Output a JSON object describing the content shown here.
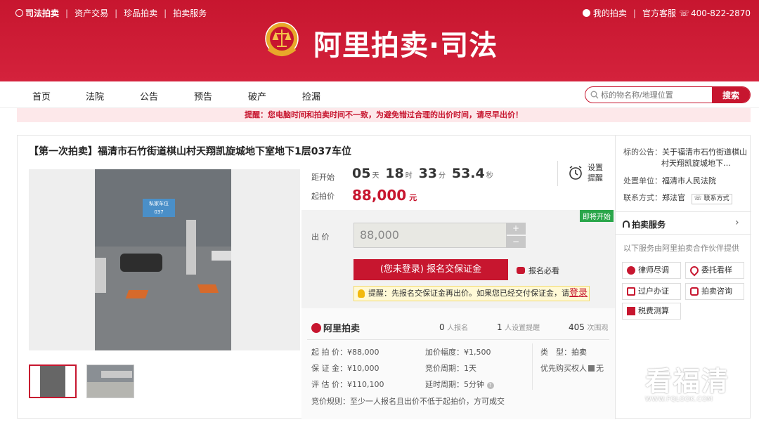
{
  "topbar": {
    "brand": "司法拍卖",
    "links": [
      "资产交易",
      "珍品拍卖",
      "拍卖服务"
    ],
    "my_auction": "我的拍卖",
    "service": "官方客服",
    "phone": "400-822-2870"
  },
  "header": {
    "title": "阿里拍卖·司法"
  },
  "nav": {
    "items": [
      "首页",
      "法院",
      "公告",
      "预告",
      "破产",
      "捡漏"
    ],
    "search_placeholder": "标的物名称/地理位置",
    "search_button": "搜索"
  },
  "notice": "提醒：您电脑时间和拍卖时间不一致，为避免错过合理的出价时间，请尽早出价！",
  "item": {
    "title": "【第一次拍卖】福清市石竹街道棋山村天翔凯旋城地下室地下1层037车位",
    "photo_sign": "私家车位\n037"
  },
  "countdown": {
    "label": "距开始",
    "days": "05",
    "days_unit": "天",
    "hours": "18",
    "hours_unit": "时",
    "minutes": "33",
    "minutes_unit": "分",
    "seconds": "53.4",
    "seconds_unit": "秒"
  },
  "remind": {
    "line1": "设置",
    "line2": "提醒"
  },
  "start_price": {
    "label": "起拍价",
    "value": "88,000",
    "unit": "元"
  },
  "bid": {
    "badge": "即将开始",
    "label": "出 价",
    "value": "88,000",
    "plus": "+",
    "minus": "−",
    "register_button": "(您未登录) 报名交保证金",
    "must_read": "报名必看",
    "tip_text": "提醒：先报名交保证金再出价。如果您已经交付保证金，请",
    "tip_link": "登录"
  },
  "stats": {
    "logo": "阿里拍卖",
    "signup_count": "0",
    "signup_label": "人报名",
    "reminder_count": "1",
    "reminder_label": "人设置提醒",
    "view_count": "405",
    "view_label": "次围观",
    "start_price": "起 拍 价：¥88,000",
    "increment": "加价幅度：¥1,500",
    "type": "类　型：",
    "type_value": "拍卖",
    "deposit": "保 证 金：¥10,000",
    "bid_period": "竞价周期：1天",
    "priority": "优先购买权人",
    "priority_value": "无",
    "appraisal": "评 估 价：¥110,100",
    "extend_period": "延时周期：5分钟",
    "rule": "竞价规则：至少一人报名且出价不低于起拍价，方可成交"
  },
  "sidebar": {
    "notice_label": "标的公告：",
    "notice_value": "关于福清市石竹街道棋山村天翔凯旋城地下…",
    "court_label": "处置单位：",
    "court_value": "福清市人民法院",
    "contact_label": "联系方式：",
    "contact_value": "郑法官",
    "contact_btn": "联系方式",
    "service_title": "拍卖服务",
    "service_desc": "以下服务由阿里拍卖合作伙伴提供",
    "services": [
      "律师尽调",
      "委托看样",
      "过户办证",
      "拍卖咨询",
      "税费测算"
    ]
  },
  "watermark": {
    "big": "看福清",
    "small": "WWW.FQLOOK.COM"
  },
  "colors": {
    "brand": "#c7162f",
    "green_badge": "#2aa64a"
  }
}
